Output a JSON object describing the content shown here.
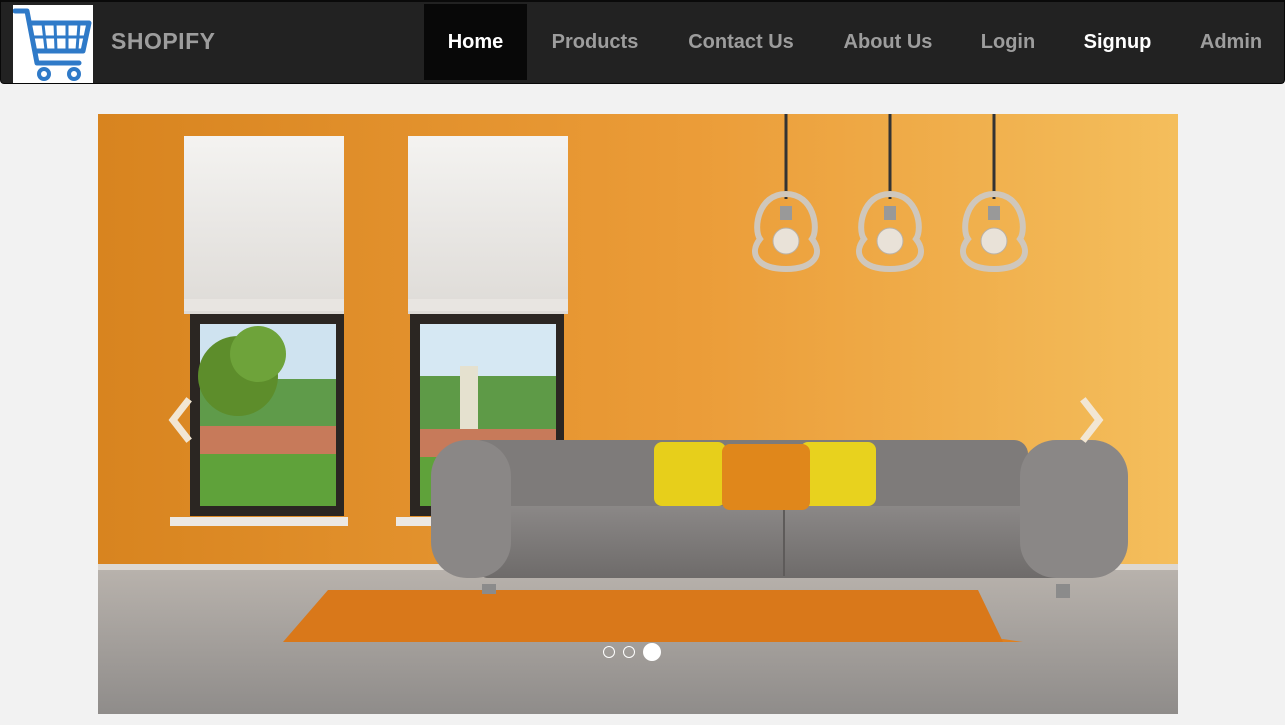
{
  "brand": {
    "name": "SHOPIFY",
    "logo_icon": "shopping-cart-icon"
  },
  "nav": {
    "items": [
      {
        "label": "Home",
        "active": true
      },
      {
        "label": "Products"
      },
      {
        "label": "Contact Us"
      },
      {
        "label": "About Us"
      },
      {
        "label": "Login"
      },
      {
        "label": "Signup"
      },
      {
        "label": "Admin"
      }
    ]
  },
  "carousel": {
    "slide_count": 3,
    "active_index": 3,
    "prev_icon": "chevron-left-icon",
    "next_icon": "chevron-right-icon"
  },
  "colors": {
    "navbar": "#222222",
    "brand_text": "#9d9d9d",
    "active_nav": "#080808",
    "cart_blue": "#2f7ac8",
    "page_bg": "#f2f2f2"
  }
}
